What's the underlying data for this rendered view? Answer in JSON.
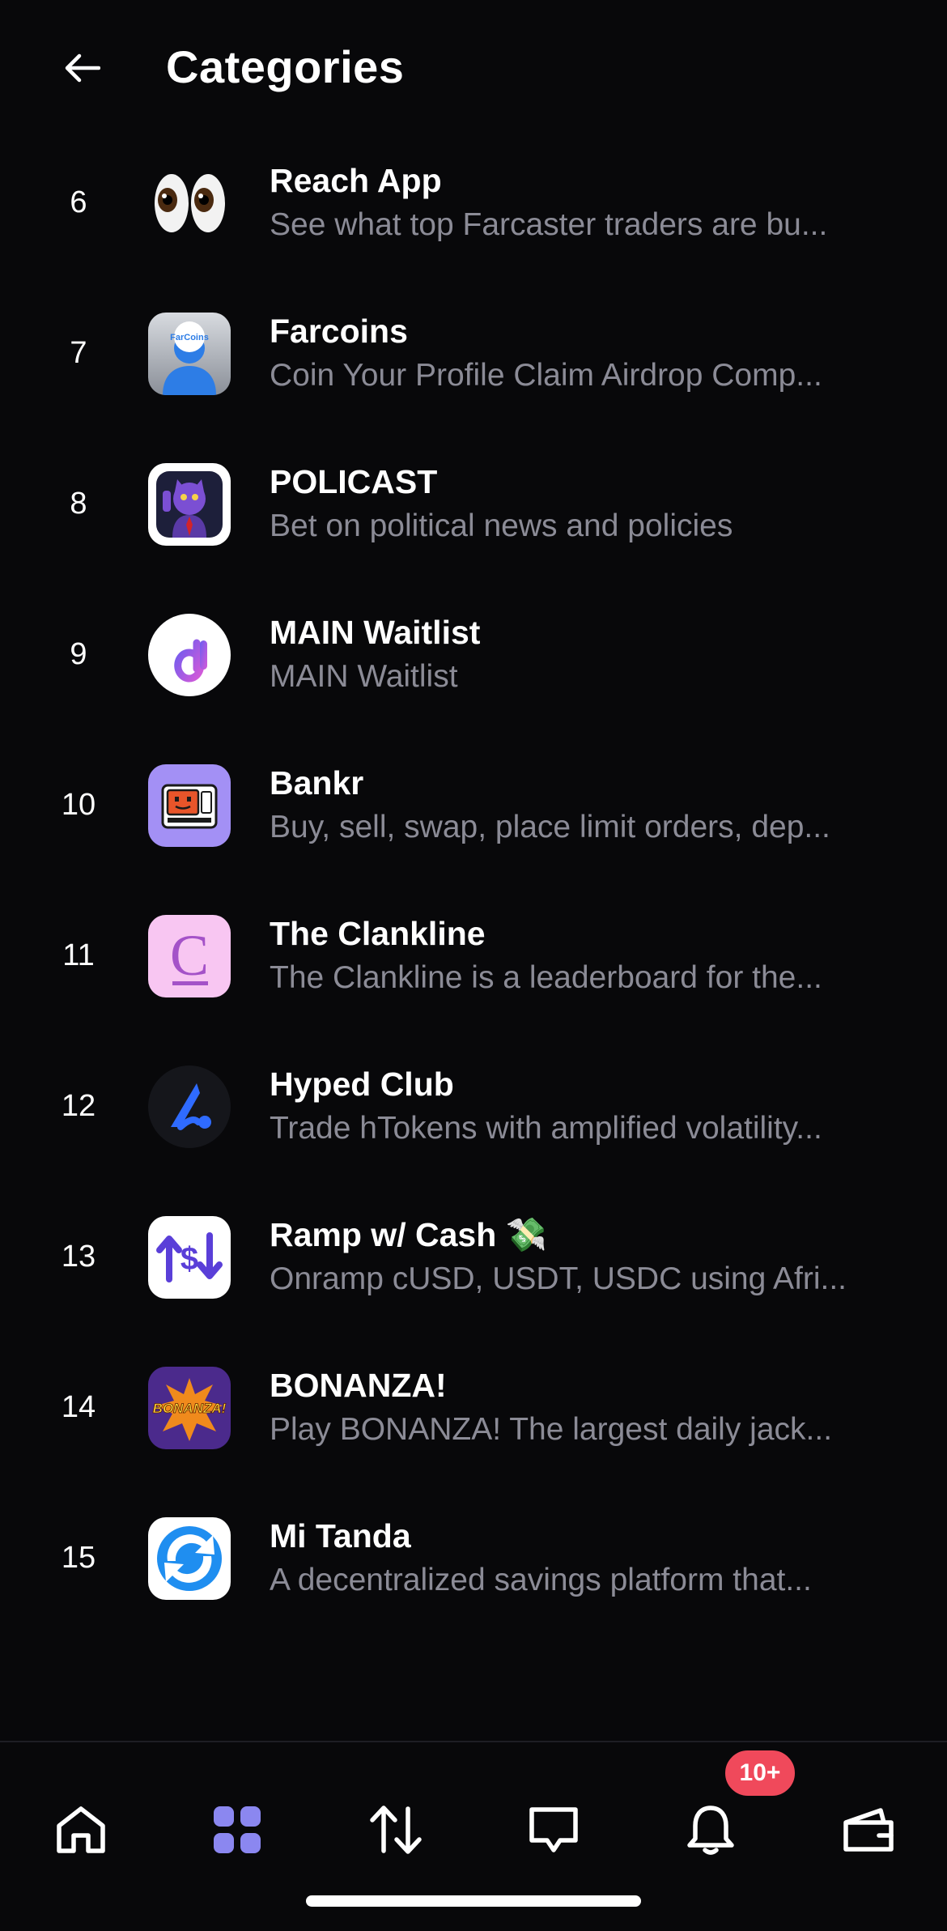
{
  "header": {
    "title": "Categories"
  },
  "apps": [
    {
      "rank": "6",
      "name": "Reach App",
      "description": "See what top Farcaster traders are bu...",
      "icon": "eyes-icon"
    },
    {
      "rank": "7",
      "name": "Farcoins",
      "description": "Coin Your Profile Claim Airdrop Comp...",
      "icon": "farcoins-icon",
      "icon_text": "FarCoins"
    },
    {
      "rank": "8",
      "name": "POLICAST",
      "description": "Bet on political news and policies",
      "icon": "policast-cat-icon"
    },
    {
      "rank": "9",
      "name": "MAIN Waitlist",
      "description": "MAIN Waitlist",
      "icon": "main-ai-icon"
    },
    {
      "rank": "10",
      "name": "Bankr",
      "description": "Buy, sell, swap, place limit orders, dep...",
      "icon": "bankr-robot-icon"
    },
    {
      "rank": "11",
      "name": "The Clankline",
      "description": "The Clankline is a leaderboard for the...",
      "icon": "clankline-c-icon",
      "icon_text": "C"
    },
    {
      "rank": "12",
      "name": "Hyped Club",
      "description": "Trade hTokens with amplified volatility...",
      "icon": "hyped-club-icon"
    },
    {
      "rank": "13",
      "name": "Ramp w/ Cash 💸",
      "description": "Onramp cUSD, USDT, USDC using Afri...",
      "icon": "ramp-arrows-icon"
    },
    {
      "rank": "14",
      "name": "BONANZA!",
      "description": "Play BONANZA! The largest daily jack...",
      "icon": "bonanza-icon",
      "icon_text": "BONANZA!"
    },
    {
      "rank": "15",
      "name": "Mi Tanda",
      "description": "A decentralized savings platform that...",
      "icon": "mi-tanda-icon"
    }
  ],
  "nav": {
    "items": [
      "home-icon",
      "grid-icon",
      "swap-arrows-icon",
      "chat-icon",
      "bell-icon",
      "wallet-icon"
    ],
    "active": "grid-icon",
    "notifications_badge": "10+"
  },
  "colors": {
    "background": "#08080a",
    "secondary_text": "#8b8b96",
    "accent": "#8b87f0",
    "badge": "#f0495b"
  }
}
